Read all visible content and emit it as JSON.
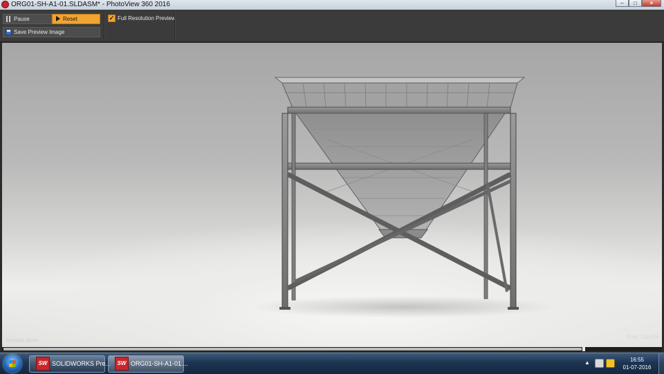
{
  "window": {
    "title": "ORG01-SH-A1-01.SLDASM* - PhotoView 360 2016",
    "minimize_glyph": "–",
    "maximize_glyph": "□",
    "close_glyph": "×"
  },
  "toolbar": {
    "pause_label": "Pause",
    "reset_label": "Reset",
    "save_label": "Save Preview Image",
    "full_res_label": "Full Resolution Preview",
    "full_res_checked": true,
    "check_glyph": "✓"
  },
  "viewport": {
    "status_left": "Render done",
    "status_right": "Size: 100.0%"
  },
  "taskbar": {
    "items": [
      {
        "label": "SOLIDWORKS Pre...",
        "icon": "solidworks-icon",
        "icon_text": "SW"
      },
      {
        "label": "ORG01-SH-A1-01....",
        "icon": "solidworks-icon",
        "icon_text": "SW"
      }
    ],
    "tray_arrow": "▲",
    "time": "16:55",
    "date": "01-07-2016"
  },
  "colors": {
    "accent": "#f2a431",
    "toolbar_bg": "#3b3b3b",
    "taskbar_bg": "#1d3452"
  }
}
